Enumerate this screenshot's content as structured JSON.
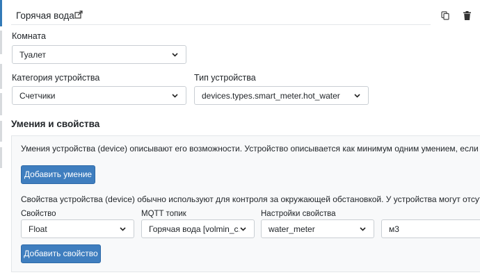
{
  "header": {
    "title": "Горячая вода",
    "edit_icon": "external-edit-icon",
    "copy_icon": "copy-icon",
    "delete_icon": "trash-icon"
  },
  "room": {
    "label": "Комната",
    "value": "Туалет"
  },
  "category": {
    "label": "Категория устройства",
    "value": "Счетчики"
  },
  "device_type": {
    "label": "Тип устройства",
    "value": "devices.types.smart_meter.hot_water"
  },
  "skills": {
    "title": "Умения и свойства",
    "skills_desc": "Умения устройства (device) описывают его возможности. Устройство описывается как минимум одним умением, если у него при этом",
    "add_skill": "Добавить умение",
    "props_desc": "Свойства устройства (device) обычно используют для контроля за окружающей обстановкой. У устройства могут отсутствовать свойства",
    "property_label": "Свойство",
    "property_value": "Float",
    "mqtt_label": "MQTT топик",
    "mqtt_value": "Горячая вода [volmin_c...",
    "settings_label": "Настройки свойства",
    "settings_value": "water_meter",
    "unit_value": "м3",
    "add_property": "Добавить свойство"
  },
  "colors": {
    "primary": "#3f7ebf",
    "rail_active": "#337ab7",
    "border": "#c9ced3"
  }
}
